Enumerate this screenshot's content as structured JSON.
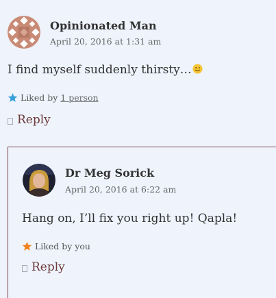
{
  "comments": [
    {
      "author": "Opinionated Man",
      "date": "April 20, 2016 at 1:31 am",
      "text": "I find myself suddenly thirsty…",
      "likes_prefix": "Liked by",
      "likes_link": "1 person",
      "reply_label": "Reply",
      "star_color": "#3aa0d8",
      "avatar_color": "#c98b76",
      "icons": {
        "avatar": "avatar-pattern-icon",
        "emoji": "smile-emoji-icon",
        "star": "star-icon"
      }
    },
    {
      "author": "Dr Meg Sorick",
      "date": "April 20, 2016 at 6:22 am",
      "text": "Hang on, I’ll fix you right up! Qapla!",
      "likes_text": "Liked by you",
      "reply_label": "Reply",
      "star_color": "#f0821e",
      "border_color": "#7a3f4a",
      "icons": {
        "avatar": "avatar-photo-icon",
        "star": "star-icon"
      }
    }
  ]
}
